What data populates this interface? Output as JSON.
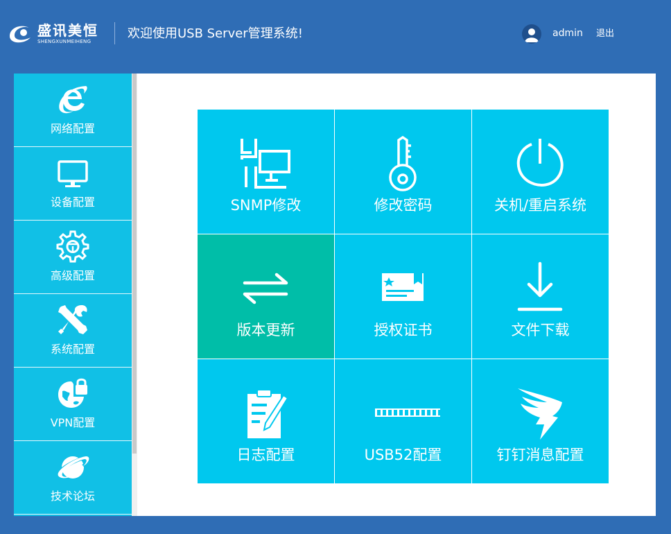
{
  "header": {
    "logo_cn": "盛讯美恒",
    "logo_en": "SHENGXUNMEIHENG",
    "welcome": "欢迎使用USB Server管理系统!",
    "username": "admin",
    "logout_label": "退出"
  },
  "sidebar": {
    "items": [
      {
        "label": "网络配置",
        "icon": "ie-icon"
      },
      {
        "label": "设备配置",
        "icon": "monitor-icon"
      },
      {
        "label": "高级配置",
        "icon": "gear-icon"
      },
      {
        "label": "系统配置",
        "icon": "tools-icon"
      },
      {
        "label": "VPN配置",
        "icon": "globe-lock-icon"
      },
      {
        "label": "技术论坛",
        "icon": "planet-icon"
      }
    ]
  },
  "tiles": [
    {
      "label": "SNMP修改",
      "icon": "snmp-network-icon",
      "color": "#00c8ee"
    },
    {
      "label": "修改密码",
      "icon": "key-icon",
      "color": "#00c8ee"
    },
    {
      "label": "关机/重启系统",
      "icon": "power-icon",
      "color": "#00c8ee"
    },
    {
      "label": "版本更新",
      "icon": "swap-arrows-icon",
      "color": "#00bea8"
    },
    {
      "label": "授权证书",
      "icon": "certificate-icon",
      "color": "#00c8ee"
    },
    {
      "label": "文件下载",
      "icon": "download-icon",
      "color": "#00c8ee"
    },
    {
      "label": "日志配置",
      "icon": "clipboard-edit-icon",
      "color": "#00c8ee"
    },
    {
      "label": "USB52配置",
      "icon": "usb-hub-icon",
      "color": "#00c8ee"
    },
    {
      "label": "钉钉消息配置",
      "icon": "dingtalk-icon",
      "color": "#00c8ee"
    }
  ],
  "colors": {
    "background": "#2f6db5",
    "sidebar": "#11c0e6",
    "tile": "#00c8ee",
    "tile_active": "#00bea8"
  }
}
